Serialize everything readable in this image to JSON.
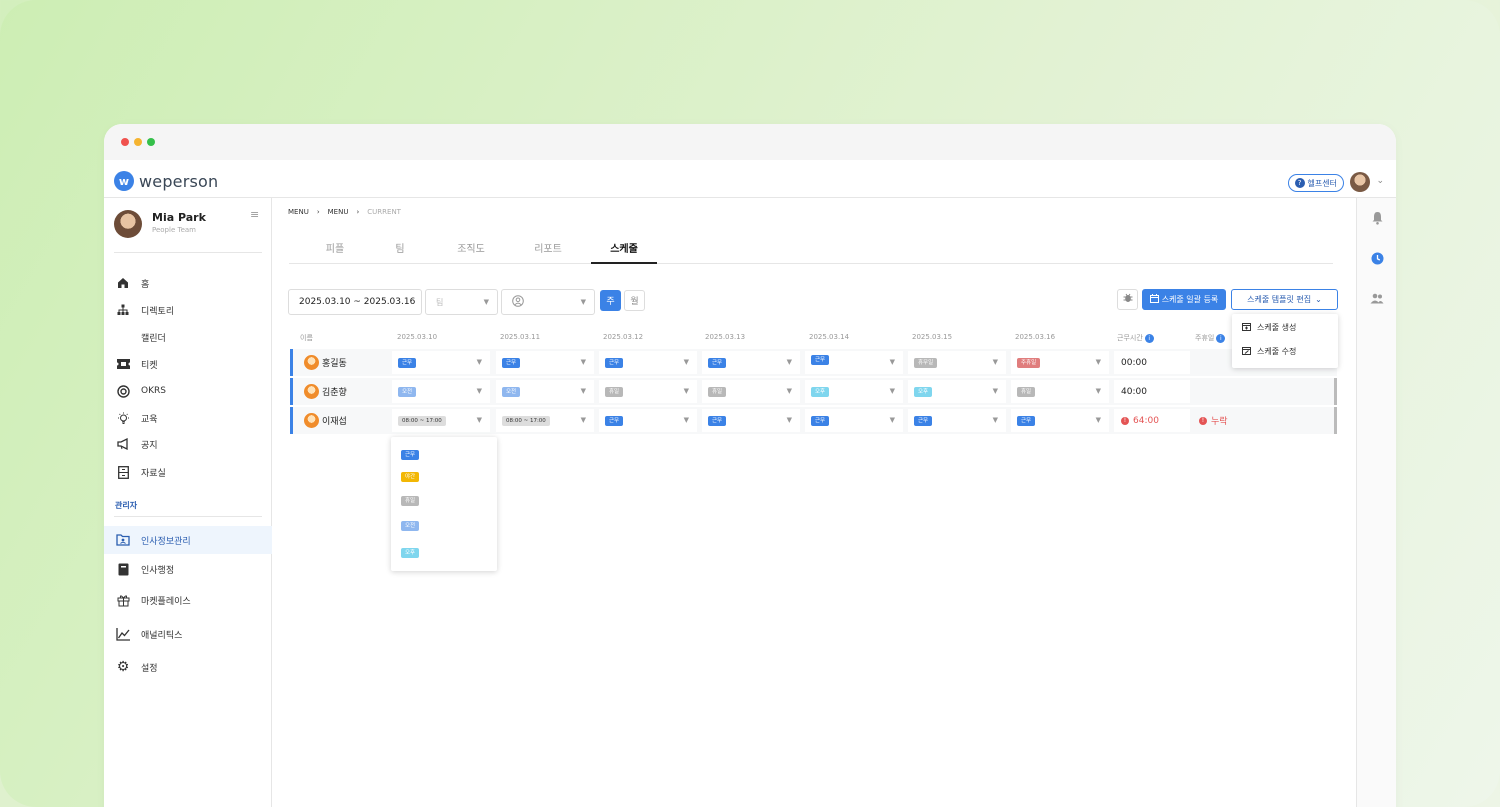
{
  "app": {
    "brand": "weperson",
    "help_label": "헬프센터"
  },
  "profile": {
    "name": "Mia Park",
    "team": "People Team"
  },
  "nav": [
    {
      "label": "홈",
      "icon": "home-icon"
    },
    {
      "label": "디렉토리",
      "icon": "org-chart-icon"
    },
    {
      "label": "캘린더",
      "icon": ""
    },
    {
      "label": "티켓",
      "icon": "ticket-icon"
    },
    {
      "label": "OKRS",
      "icon": "target-icon"
    },
    {
      "label": "교육",
      "icon": "lightbulb-icon"
    },
    {
      "label": "공지",
      "icon": "megaphone-icon"
    },
    {
      "label": "자료실",
      "icon": "cabinet-icon"
    }
  ],
  "admin": {
    "label": "관리자",
    "items": [
      {
        "label": "인사정보관리",
        "icon": "folder-user-icon"
      },
      {
        "label": "인사행정",
        "icon": "book-icon"
      },
      {
        "label": "마켓플레이스",
        "icon": "gift-icon"
      },
      {
        "label": "애널리틱스",
        "icon": "chart-icon"
      },
      {
        "label": "설정",
        "icon": "gear-icon"
      }
    ]
  },
  "breadcrumb": [
    "MENU",
    "MENU",
    "CURRENT"
  ],
  "tabs": [
    "피플",
    "팀",
    "조직도",
    "리포트",
    "스케줄"
  ],
  "active_tab": "스케줄",
  "filters": {
    "date_range": "2025.03.10 ~ 2025.03.16",
    "team_placeholder": "팀",
    "week": "주",
    "month": "월"
  },
  "toolbar": {
    "bulk": "스케줄 일괄 등록",
    "template": "스케줄 템플릿 편집"
  },
  "template_menu": [
    "스케줄 생성",
    "스케줄 수정"
  ],
  "table": {
    "headers": [
      "이름",
      "2025.03.10",
      "2025.03.11",
      "2025.03.12",
      "2025.03.13",
      "2025.03.14",
      "2025.03.15",
      "2025.03.16",
      "근무시간",
      "주휴일"
    ],
    "rows": [
      {
        "name": "홍길동",
        "cells": [
          "근무",
          "근무",
          "근무",
          "근무",
          "근무",
          "휴무일",
          "주휴일"
        ],
        "hours": "00:00",
        "weekly_off": ""
      },
      {
        "name": "김춘향",
        "cells": [
          "오전",
          "오전",
          "휴일",
          "휴일",
          "오후",
          "오후",
          "휴일"
        ],
        "hours": "40:00",
        "weekly_off": ""
      },
      {
        "name": "이재섭",
        "cells": [
          "08:00 ~ 17:00",
          "08:00 ~ 17:00",
          "근무",
          "근무",
          "근무",
          "근무",
          "근무"
        ],
        "hours": "64:00",
        "weekly_off": "누락"
      }
    ]
  },
  "dropdown_options": [
    "근무",
    "야간",
    "휴일",
    "오전",
    "오후"
  ],
  "colors": {
    "accent": "#3b82e6",
    "warning": "#e45454",
    "night": "#f2b705",
    "weekly_off": "#e07d7d"
  }
}
